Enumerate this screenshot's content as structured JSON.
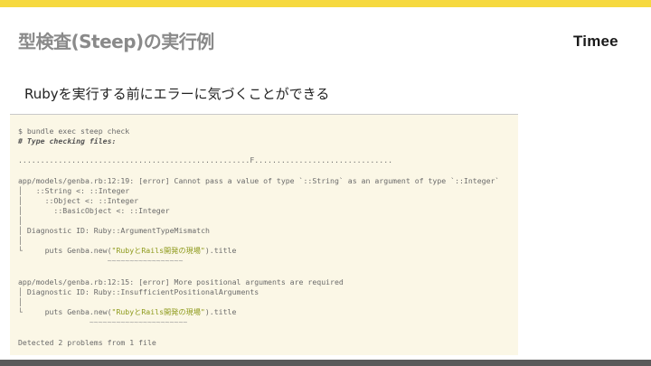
{
  "slide": {
    "title": "型検査(Steep)の実行例",
    "brand": "Timee",
    "subtitle": "Rubyを実行する前にエラーに気づくことができる"
  },
  "colors": {
    "accent_bar": "#f6d93f",
    "bottom_bar": "#5a5a5a",
    "code_background": "#fbf7e6",
    "string_color": "#8e9a1c"
  },
  "terminal": {
    "command": "$ bundle exec steep check",
    "comment": "# Type checking files:",
    "progress": "....................................................F...............................",
    "error1": {
      "location": "app/models/genba.rb:12:19: [error] Cannot pass a value of type `::String` as an argument of type `::Integer`",
      "trace1": "│   ::String <: ::Integer",
      "trace2": "│     ::Object <: ::Integer",
      "trace3": "│       ::BasicObject <: ::Integer",
      "trace_pipe": "│",
      "diagnostic": "│ Diagnostic ID: Ruby::ArgumentTypeMismatch",
      "trace_pipe2": "│",
      "code_prefix": "└     puts Genba.new(",
      "code_string": "\"RubyとRails開発の現場\"",
      "code_suffix": ").title",
      "squiggle": "                    ~~~~~~~~~~~~~~~~~"
    },
    "error2": {
      "location": "app/models/genba.rb:12:15: [error] More positional arguments are required",
      "diagnostic": "│ Diagnostic ID: Ruby::InsufficientPositionalArguments",
      "trace_pipe": "│",
      "code_prefix": "└     puts Genba.new(",
      "code_string": "\"RubyとRails開発の現場\"",
      "code_suffix": ").title",
      "squiggle": "                ~~~~~~~~~~~~~~~~~~~~~~"
    },
    "summary": "Detected 2 problems from 1 file"
  }
}
